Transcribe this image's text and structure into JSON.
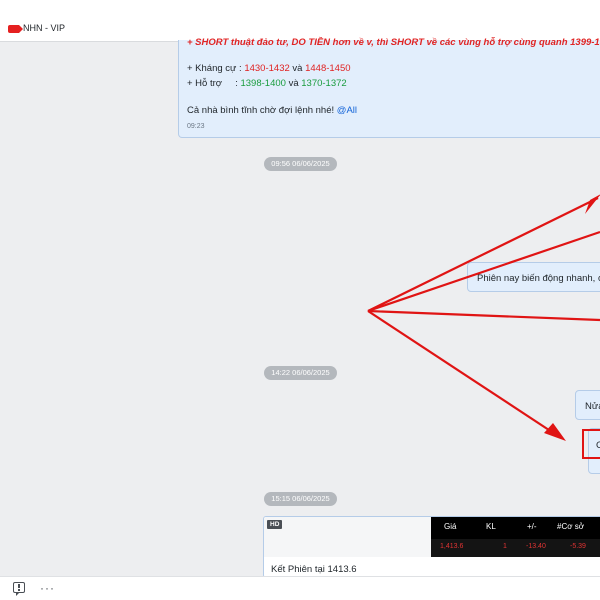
{
  "window": {
    "channel_name": "NHN - VIP",
    "channel_icon": "video-channel-icon"
  },
  "message1": {
    "cut_line": "+ SHORT thuật đảo tư, DO TIỀN hơn về v, thì SHORT về các vùng hỗ trợ cùng quanh 1399-1376 ở",
    "resistance_label": "+ Kháng cự :",
    "resistance_1": "1430-1432",
    "and_1": "và",
    "resistance_2": "1448-1450",
    "support_label": "+ Hỗ trợ     :",
    "support_1": "1398-1400",
    "and_2": "và",
    "support_2": "1370-1372",
    "closing": "Cả nhà bình tĩnh chờ đợi lệnh nhé!",
    "mention": "@All",
    "time": "09:23"
  },
  "separator1": "09:56 06/06/2025",
  "message2": "Phiên nay biến động nhanh, cả",
  "separator2": "14:22 06/06/2025",
  "message3": "Nửa",
  "message4_initial": "C",
  "separator3": "15:15 06/06/2025",
  "card": {
    "badge": "HD",
    "columns": [
      "Giá",
      "KL",
      "+/-",
      "#Cơ sở"
    ],
    "row": [
      "1,413.6",
      "1",
      "-13.40",
      "-5.39"
    ],
    "caption": "Kết Phiên tại 1413.6"
  },
  "toolbar": {
    "reply_icon": "reply-icon",
    "more_icon": "more-options-icon",
    "more_glyph": "···"
  },
  "colors": {
    "annotation": "#e01414",
    "red_value": "#e02323",
    "green_value": "#1a9c3e",
    "mention": "#1565d8"
  }
}
